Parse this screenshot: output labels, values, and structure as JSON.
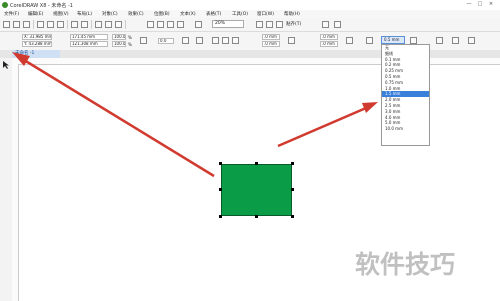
{
  "window": {
    "title": "CorelDRAW X8 - 未命名 -1",
    "controls": [
      "—",
      "□",
      "×"
    ]
  },
  "menu": {
    "items": [
      "文件(F)",
      "编辑(E)",
      "视图(V)",
      "布局(L)",
      "对象(C)",
      "效果(C)",
      "位图(B)",
      "文本(X)",
      "表格(T)",
      "工具(O)",
      "窗口(W)",
      "帮助(H)"
    ]
  },
  "toolbar": {
    "zoom": "20%",
    "snap_label": "贴齐(T)"
  },
  "property_bar": {
    "x": "X: 31.985 mm",
    "y": "Y: 43.288 mm",
    "width": "171.45 mm",
    "height": "121.308 mm",
    "scale_w": "100.0",
    "scale_h": "100.0",
    "scale_unit": "%",
    "rotation": "0.0",
    "corner_1": ".0 mm",
    "corner_2": ".0 mm",
    "corner_3": ".0 mm",
    "corner_4": ".0 mm",
    "outline_width": "0.5 mm"
  },
  "document": {
    "tab_label": "未命名 -1",
    "shape_fill": "#0a9c47"
  },
  "outline_dropdown": {
    "options": [
      "无",
      "细线",
      "0.1 mm",
      "0.2 mm",
      "0.25 mm",
      "0.5 mm",
      "0.75 mm",
      "1.0 mm",
      "1.5 mm",
      "2.0 mm",
      "2.5 mm",
      "3.0 mm",
      "4.0 mm",
      "5.0 mm",
      "10.0 mm"
    ],
    "selected_index": 8
  },
  "watermark": "软件技巧",
  "colors": {
    "accent": "#3a7fd9",
    "arrow": "#d13a2f",
    "shape": "#0a9c47"
  }
}
